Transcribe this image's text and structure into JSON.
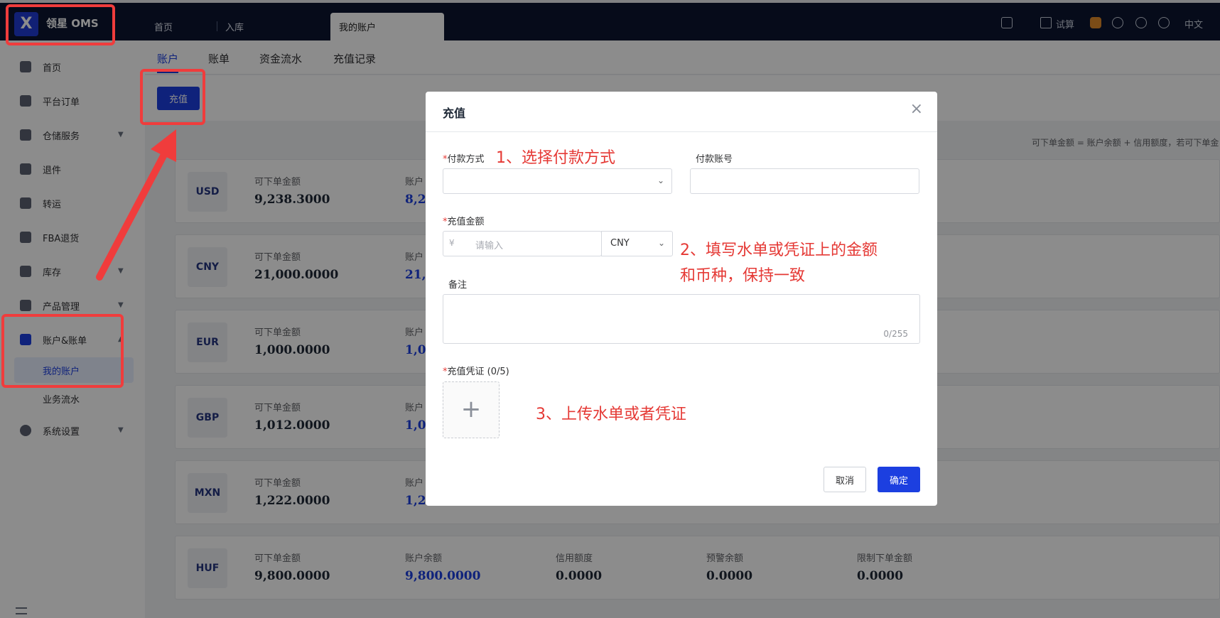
{
  "app": {
    "logo_glyph": "X",
    "title": "领星 OMS"
  },
  "nav_tabs": [
    {
      "label": "首页"
    },
    {
      "label": "入库"
    },
    {
      "label": "我的账户"
    }
  ],
  "topbar_right": {
    "trial": "试算",
    "language": "中文"
  },
  "sidebar": {
    "items": [
      {
        "label": "首页",
        "icon": "home-icon"
      },
      {
        "label": "平台订单",
        "icon": "clipboard-icon"
      },
      {
        "label": "仓储服务",
        "icon": "warehouse-icon"
      },
      {
        "label": "退件",
        "icon": "return-icon"
      },
      {
        "label": "转运",
        "icon": "truck-icon"
      },
      {
        "label": "FBA退货",
        "icon": "amazon-icon"
      },
      {
        "label": "库存",
        "icon": "inventory-icon"
      },
      {
        "label": "产品管理",
        "icon": "product-icon"
      },
      {
        "label": "账户&账单",
        "icon": "account-icon"
      },
      {
        "label": "系统设置",
        "icon": "settings-icon"
      }
    ],
    "sub_items": [
      {
        "label": "我的账户"
      },
      {
        "label": "业务流水"
      }
    ]
  },
  "subtabs": [
    {
      "label": "账户"
    },
    {
      "label": "账单"
    },
    {
      "label": "资金流水"
    },
    {
      "label": "充值记录"
    }
  ],
  "toolbar": {
    "recharge_label": "充值"
  },
  "hint": "可下单金额 = 账户余额 + 信用额度，若可下单金",
  "accounts": [
    {
      "currency": "USD",
      "orderable_label": "可下单金额",
      "orderable": "9,238.3000",
      "balance_label": "账户",
      "balance": "8,2"
    },
    {
      "currency": "CNY",
      "orderable_label": "可下单金额",
      "orderable": "21,000.0000",
      "balance_label": "账户",
      "balance": "21,"
    },
    {
      "currency": "EUR",
      "orderable_label": "可下单金额",
      "orderable": "1,000.0000",
      "balance_label": "账户",
      "balance": "1,0"
    },
    {
      "currency": "GBP",
      "orderable_label": "可下单金额",
      "orderable": "1,012.0000",
      "balance_label": "账户",
      "balance": "1,0"
    },
    {
      "currency": "MXN",
      "orderable_label": "可下单金额",
      "orderable": "1,222.0000",
      "balance_label": "账户",
      "balance": "1,2"
    },
    {
      "currency": "HUF",
      "orderable_label": "可下单金额",
      "orderable": "9,800.0000",
      "balance_label": "账户余额",
      "balance": "9,800.0000",
      "credit_label": "信用额度",
      "credit": "0.0000",
      "warning_label": "预警余额",
      "warning": "0.0000",
      "limit_label": "限制下单金额",
      "limit": "0.0000"
    }
  ],
  "dialog": {
    "title": "充值",
    "close": "×",
    "payment_method_label": "付款方式",
    "payment_account_label": "付款账号",
    "amount_label": "充值金额",
    "currency_symbol": "¥",
    "amount_placeholder": "请输入",
    "currency": "CNY",
    "remark_label": "备注",
    "remark_counter": "0/255",
    "voucher_label": "充值凭证 (0/5)",
    "upload_plus": "+",
    "cancel": "取消",
    "confirm": "确定"
  },
  "annotations": {
    "step1": "1、选择付款方式",
    "step2_line1": "2、填写水单或凭证上的金额",
    "step2_line2": "和币种，保持一致",
    "step3": "3、上传水单或者凭证"
  },
  "colors": {
    "primary": "#1c3fe0",
    "annotation": "#f03c3c",
    "topbar": "#0b1530"
  }
}
